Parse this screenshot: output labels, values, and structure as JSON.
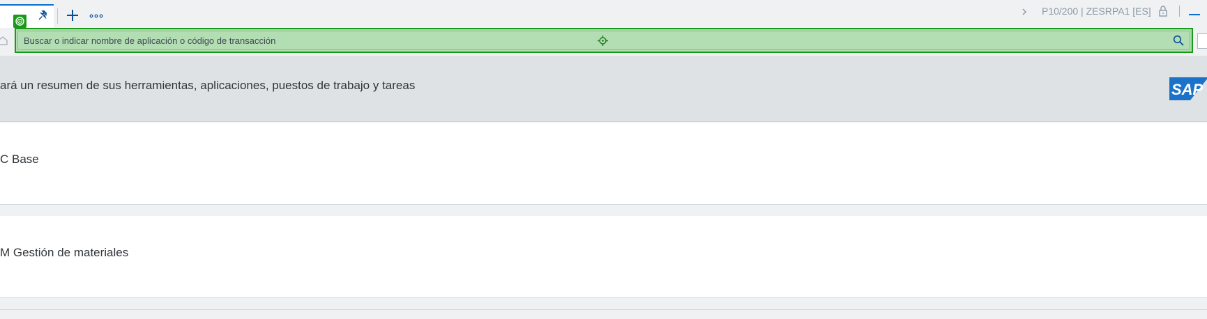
{
  "tabbar": {
    "system": "P10/200 | ZESRPA1 [ES]",
    "icons": [
      "pin-icon",
      "plus-icon",
      "more-icon",
      "chevron-right-icon",
      "lock-icon",
      "minimize-icon"
    ]
  },
  "search": {
    "placeholder": "Buscar o indicar nombre de aplicación o código de transacción",
    "highlight_color": "#1a9a1a"
  },
  "banner": {
    "text": "ará un resumen de sus herramientas, aplicaciones, puestos de trabajo y tareas",
    "logo": "SAP"
  },
  "cards": [
    {
      "label": "C Base"
    },
    {
      "label": "M Gestión de materiales"
    }
  ],
  "colors": {
    "accent": "#0a6ed1",
    "banner": "#dfe2e4",
    "logo": "#1a73c8"
  }
}
